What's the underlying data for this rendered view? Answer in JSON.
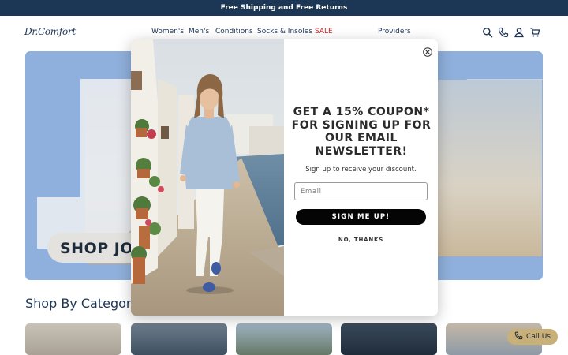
{
  "announcement": "Free Shipping and Free Returns",
  "logo": "Dr.Comfort",
  "nav": {
    "items": [
      "Women's",
      "Men's",
      "Conditions",
      "Socks & Insoles",
      "SALE",
      "Providers"
    ]
  },
  "header_icons": [
    "search-icon",
    "phone-icon",
    "account-icon",
    "cart-icon"
  ],
  "hero": {
    "letters": "JOY",
    "cta": "SHOP JO"
  },
  "section": {
    "title": "Shop By Category"
  },
  "popup": {
    "headline": "GET A 15% COUPON* FOR SIGNING UP FOR OUR EMAIL NEWSLETTER!",
    "subtext": "Sign up to receive your discount.",
    "email_placeholder": "Email",
    "signup_label": "SIGN ME UP!",
    "decline_label": "NO, THANKS"
  },
  "call_us": "Call Us",
  "colors": {
    "announcement_bg": "#1b3755",
    "sale": "#c62828",
    "hero_bg": "#8fb0dc",
    "signup_button": "#050505",
    "call_us_bg": "#c9b079"
  }
}
